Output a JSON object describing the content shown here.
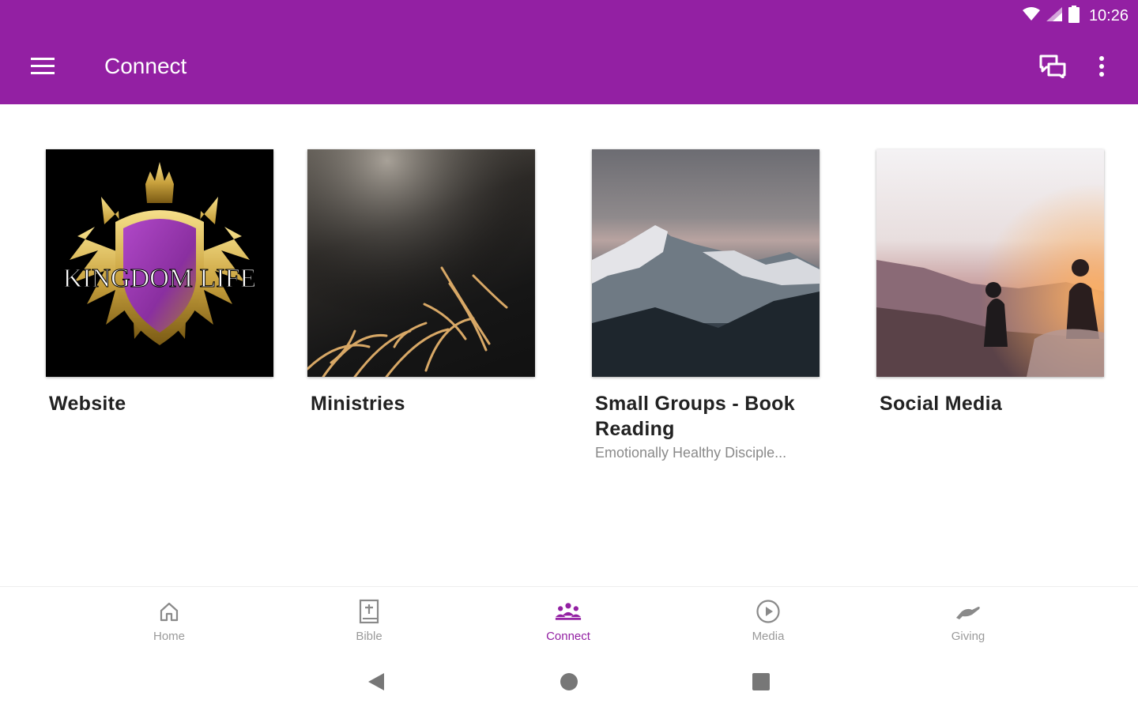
{
  "status_bar": {
    "time": "10:26",
    "icons": [
      "wifi-icon",
      "signal-icon",
      "battery-icon"
    ]
  },
  "app_bar": {
    "title": "Connect",
    "icons": [
      "menu-icon",
      "chat-icon",
      "more-vert-icon"
    ]
  },
  "logo_text": "KINGDOM LIFE",
  "cards": [
    {
      "title": "Website",
      "subtitle": ""
    },
    {
      "title": "Ministries",
      "subtitle": ""
    },
    {
      "title": "Small Groups - Book Reading",
      "subtitle": "Emotionally Healthy Disciple..."
    },
    {
      "title": "Social Media",
      "subtitle": ""
    }
  ],
  "bottom_nav": {
    "items": [
      {
        "label": "Home",
        "icon": "home-icon",
        "active": false
      },
      {
        "label": "Bible",
        "icon": "bible-icon",
        "active": false
      },
      {
        "label": "Connect",
        "icon": "people-icon",
        "active": true
      },
      {
        "label": "Media",
        "icon": "play-circle-icon",
        "active": false
      },
      {
        "label": "Giving",
        "icon": "giving-hand-icon",
        "active": false
      }
    ]
  },
  "system_nav": [
    "back-icon",
    "home-circle-icon",
    "recents-icon"
  ],
  "colors": {
    "primary": "#9320a3",
    "inactive": "#9a9a9a",
    "text": "#222222",
    "subtitle": "#8a8a8a"
  }
}
